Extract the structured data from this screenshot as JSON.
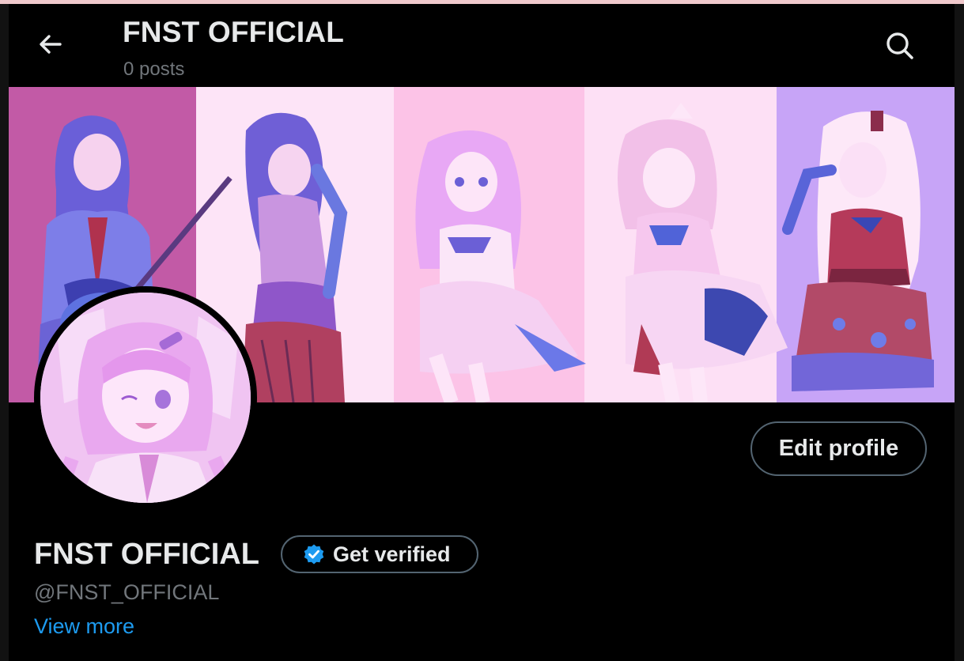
{
  "header": {
    "title": "FNST OFFICIAL",
    "post_count": "0 posts"
  },
  "profile": {
    "display_name": "FNST OFFICIAL",
    "handle": "@FNST_OFFICIAL",
    "edit_label": "Edit profile",
    "verify_label": "Get verified",
    "view_more_label": "View more"
  },
  "colors": {
    "background": "#000000",
    "primary_text": "#e7e9ea",
    "secondary_text": "#71767b",
    "link": "#1d9bf0",
    "verified_badge": "#1d9bf0",
    "button_border": "#536471",
    "banner_panels": [
      "#c25aa6",
      "#fde4f7",
      "#fcc3e7",
      "#fde0f5",
      "#c7a4f7"
    ]
  },
  "icons": {
    "back": "arrow-left-icon",
    "search": "search-icon",
    "verified": "verified-badge-icon"
  }
}
